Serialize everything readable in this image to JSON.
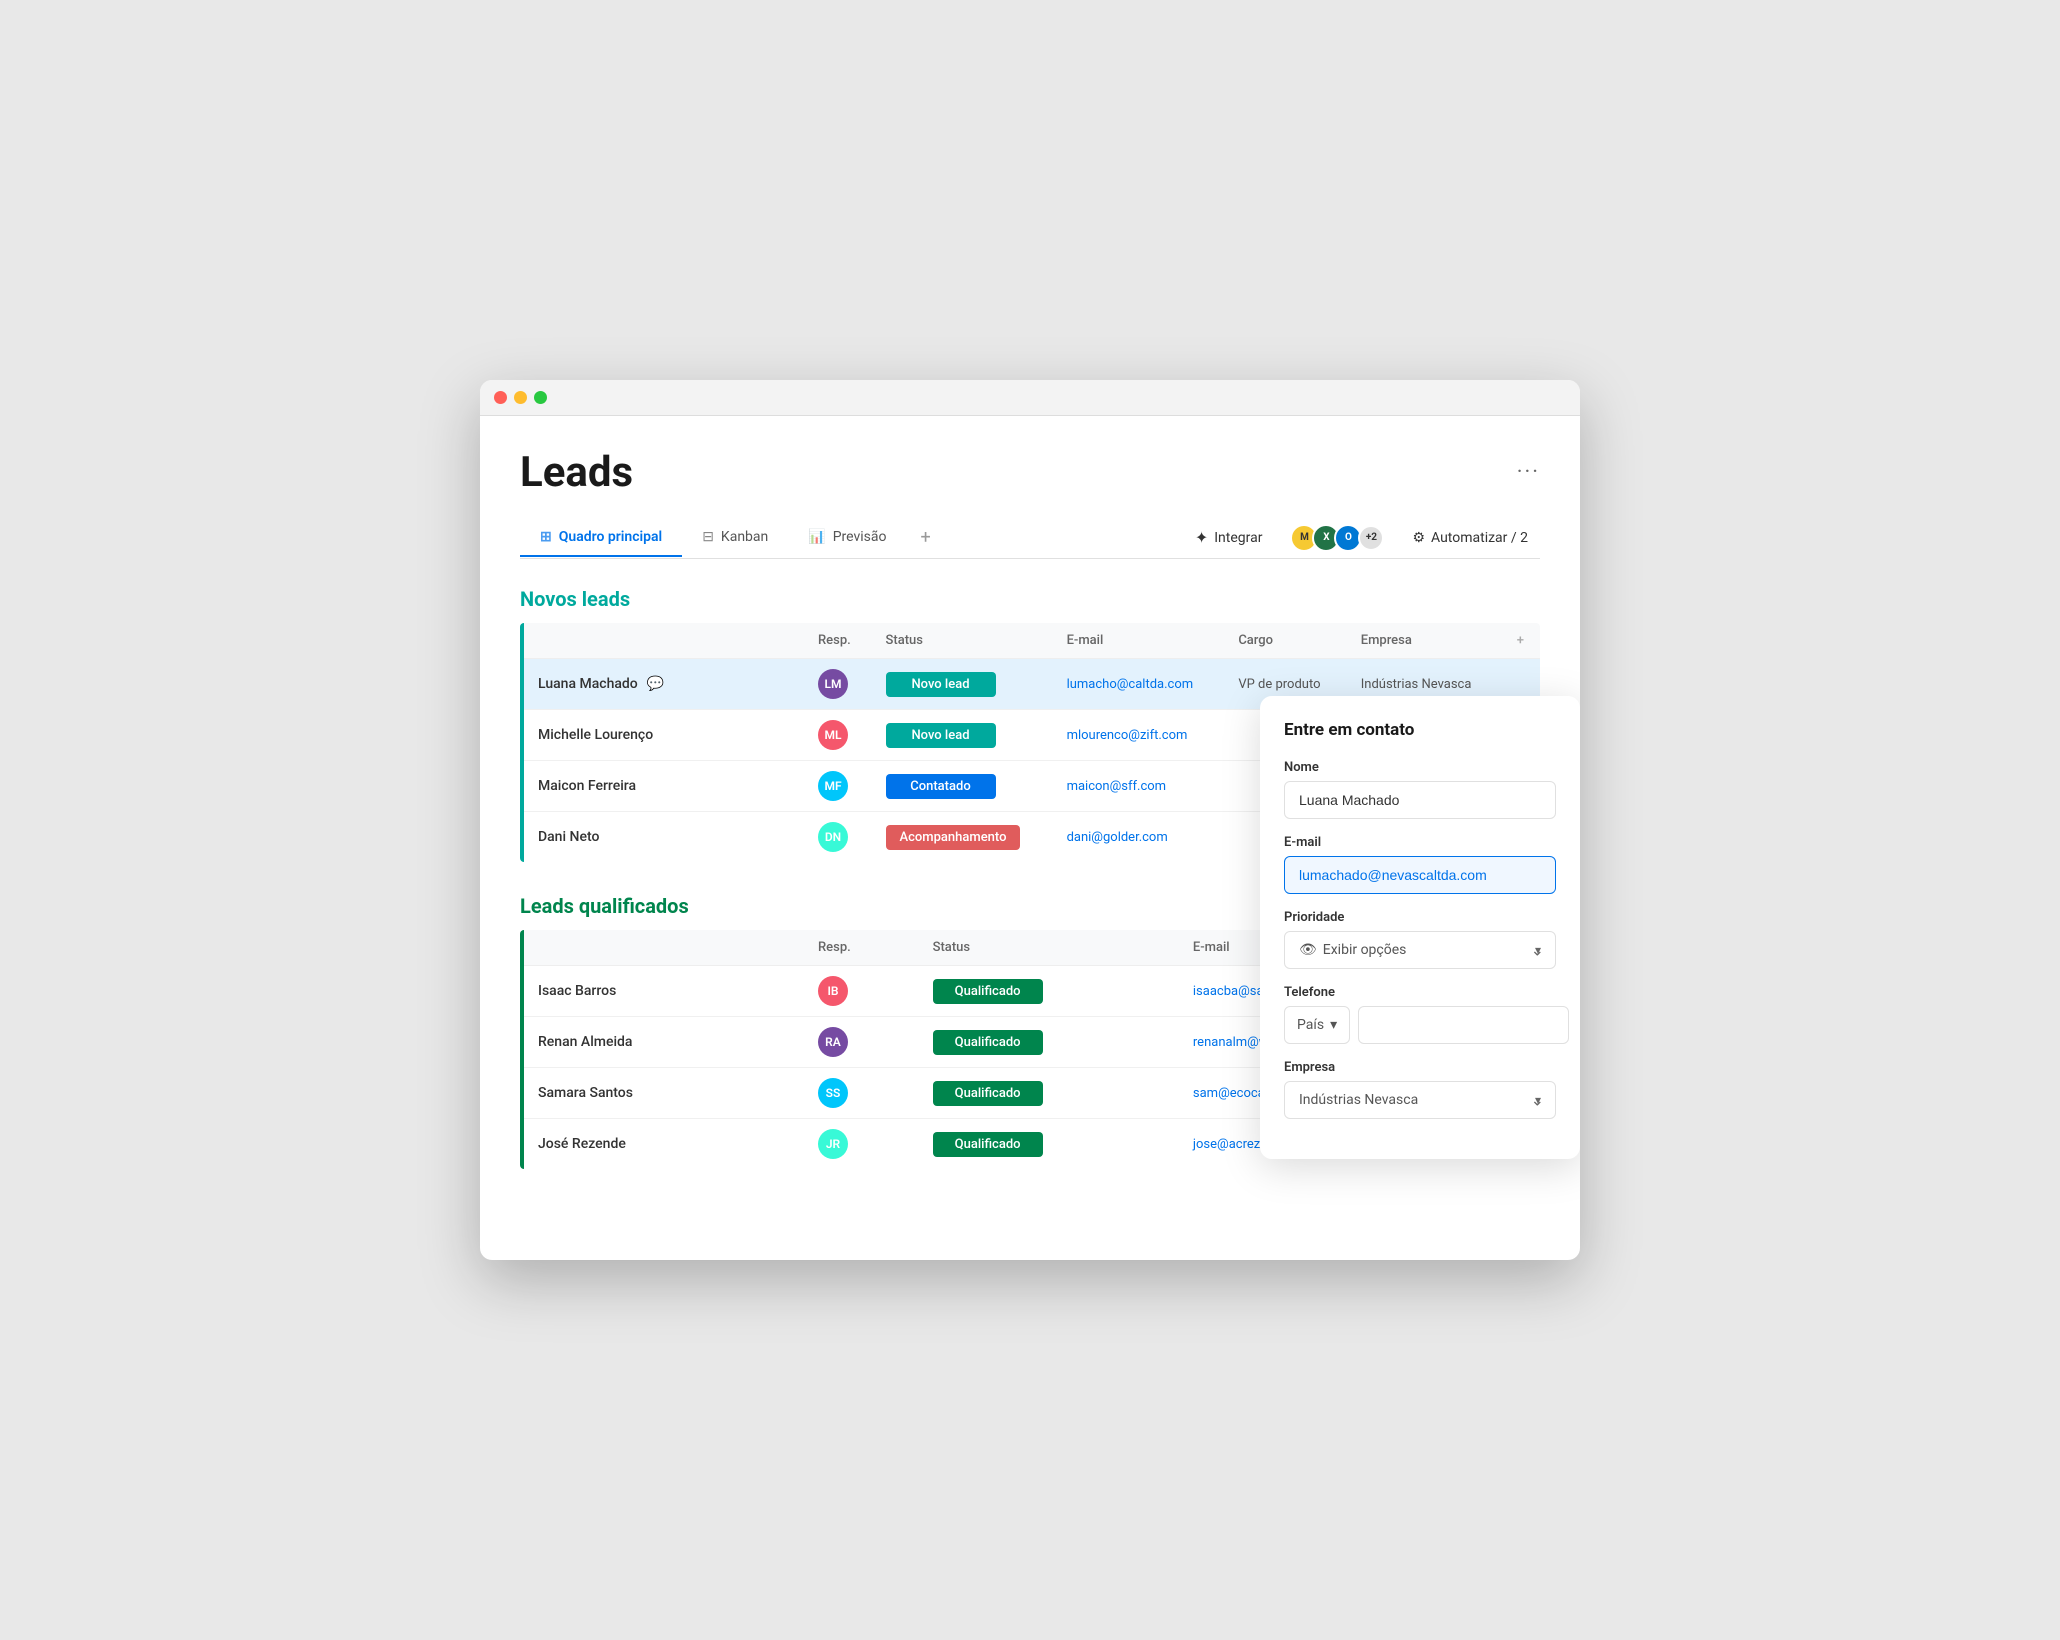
{
  "app": {
    "title": "Leads"
  },
  "tabs": [
    {
      "id": "main",
      "label": "Quadro principal",
      "icon": "⊞",
      "active": true
    },
    {
      "id": "kanban",
      "label": "Kanban",
      "icon": "⊟",
      "active": false
    },
    {
      "id": "preview",
      "label": "Previsão",
      "icon": "📊",
      "active": false
    }
  ],
  "toolbar": {
    "add_label": "+",
    "integrate_label": "Integrar",
    "automate_label": "Automatizar / 2",
    "avatar_count": "+2",
    "more_menu": "···"
  },
  "novos_leads": {
    "section_title": "Novos leads",
    "columns": [
      "Resp.",
      "Status",
      "E-mail",
      "Cargo",
      "Empresa"
    ],
    "rows": [
      {
        "name": "Luana Machado",
        "status": "Novo lead",
        "status_class": "status-novo",
        "email": "lumacho@caltda.com",
        "cargo": "VP de produto",
        "empresa": "Indústrias Nevasca",
        "highlighted": true
      },
      {
        "name": "Michelle Lourenço",
        "status": "Novo lead",
        "status_class": "status-novo",
        "email": "mlourenco@zift.com",
        "cargo": "",
        "empresa": "",
        "highlighted": false
      },
      {
        "name": "Maicon Ferreira",
        "status": "Contatado",
        "status_class": "status-contatado",
        "email": "maicon@sff.com",
        "cargo": "",
        "empresa": "",
        "highlighted": false
      },
      {
        "name": "Dani Neto",
        "status": "Acompanhamento",
        "status_class": "status-acompanhamento",
        "email": "dani@golder.com",
        "cargo": "",
        "empresa": "",
        "highlighted": false
      }
    ]
  },
  "leads_qualificados": {
    "section_title": "Leads qualificados",
    "columns": [
      "Resp.",
      "Status",
      "E-mail"
    ],
    "rows": [
      {
        "name": "Isaac Barros",
        "status": "Qualificado",
        "status_class": "status-qualificado",
        "email": "isaacba@sami.com",
        "highlighted": false
      },
      {
        "name": "Renan Almeida",
        "status": "Qualificado",
        "status_class": "status-qualificado",
        "email": "renanalm@weiss.com",
        "highlighted": false
      },
      {
        "name": "Samara Santos",
        "status": "Qualificado",
        "status_class": "status-qualificado",
        "email": "sam@ecocampo.com",
        "highlighted": false
      },
      {
        "name": "José Rezende",
        "status": "Qualificado",
        "status_class": "status-qualificado",
        "email": "jose@acrezende.com",
        "highlighted": false
      }
    ]
  },
  "side_panel": {
    "title": "Entre em contato",
    "fields": {
      "nome_label": "Nome",
      "nome_value": "Luana Machado",
      "email_label": "E-mail",
      "email_value": "lumachado@nevascaltda.com",
      "prioridade_label": "Prioridade",
      "prioridade_placeholder": "Exibir opções",
      "telefone_label": "Telefone",
      "telefone_country": "País",
      "empresa_label": "Empresa",
      "empresa_value": "Indústrias Nevasca"
    }
  },
  "colors": {
    "teal": "#00a99d",
    "green": "#00854d",
    "blue": "#0073ea",
    "red": "#e05c5c"
  }
}
